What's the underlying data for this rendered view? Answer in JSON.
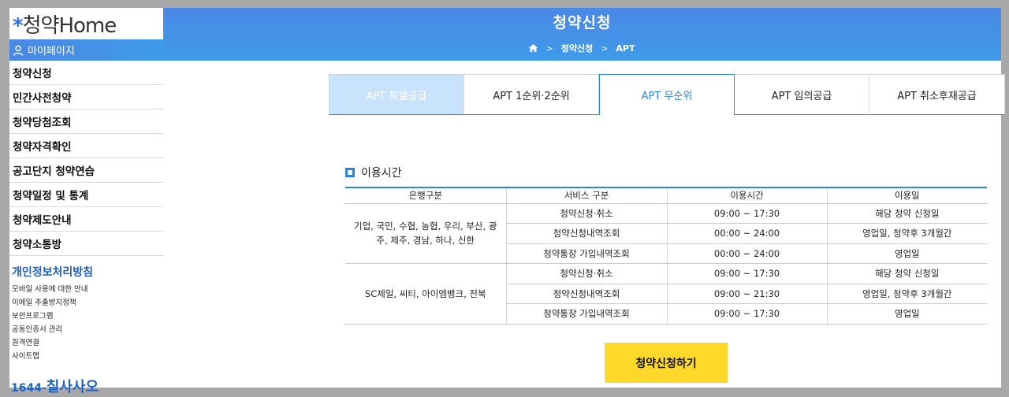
{
  "logo": {
    "star": "*",
    "text": "약Home",
    "prefix": "청"
  },
  "sidebar": {
    "mypage_label": "마이페이지",
    "items": [
      "청약신청",
      "민간사전청약",
      "청약당첨조회",
      "청약자격확인",
      "공고단지 청약연습",
      "청약일정 및 통계",
      "청약제도안내",
      "청약소통방"
    ],
    "privacy_title": "개인정보처리방침",
    "sub_links": [
      "모바일 사용에 대한 안내",
      "이메일 추출방지정책",
      "보안프로그램",
      "공동인증서 관리",
      "원격연결",
      "사이트맵"
    ],
    "phone_prefix": "1644-",
    "phone_main": "칠사사오"
  },
  "hero": {
    "title": "청약신청",
    "breadcrumb": [
      "청약신청",
      "APT"
    ]
  },
  "tabs": [
    "APT 특별공급",
    "APT 1순위·2순위",
    "APT 무순위",
    "APT 임의공급",
    "APT 취소후재공급"
  ],
  "section": {
    "title": "이용시간",
    "headers": [
      "은행구분",
      "서비스 구분",
      "이용시간",
      "이용일"
    ],
    "groups": [
      {
        "bank": "기업, 국민, 수협, 농협, 우리, 부산, 광주, 제주, 경남, 하나, 신한",
        "rows": [
          {
            "service": "청약신청·취소",
            "time": "09:00 ~ 17:30",
            "day": "해당 청약 신청일"
          },
          {
            "service": "청약신청내역조회",
            "time": "00:00 ~ 24:00",
            "day": "영업일, 청약후 3개월간"
          },
          {
            "service": "청약통장 가입내역조회",
            "time": "00:00 ~ 24:00",
            "day": "영업일"
          }
        ]
      },
      {
        "bank": "SC제일, 씨티, 아이엠뱅크, 전북",
        "rows": [
          {
            "service": "청약신청·취소",
            "time": "09:00 ~ 17:30",
            "day": "해당 청약 신청일"
          },
          {
            "service": "청약신청내역조회",
            "time": "09:00 ~ 21:30",
            "day": "영업일, 청약후 3개월간"
          },
          {
            "service": "청약통장 가입내역조회",
            "time": "09:00 ~ 17:30",
            "day": "영업일"
          }
        ]
      }
    ]
  },
  "apply_button": "청약신청하기",
  "colors": {
    "accent": "#2a86d8",
    "button": "#ffd92a",
    "tab_inactive_bg": "#c8e3fb"
  }
}
